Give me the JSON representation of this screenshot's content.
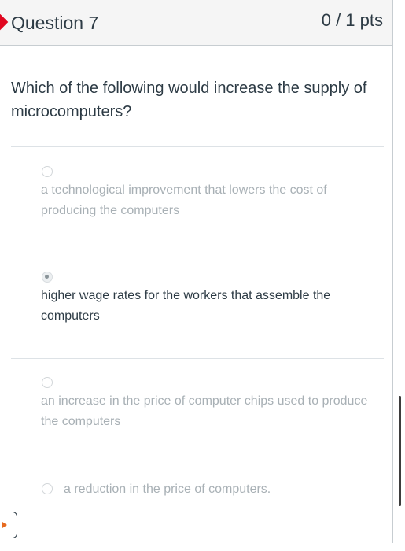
{
  "question": {
    "title": "Question 7",
    "points": "0 / 1 pts",
    "text": "Which of the following would increase the supply of microcomputers?"
  },
  "answers": [
    {
      "label": "a technological improvement that lowers the cost of producing the computers",
      "selected": false
    },
    {
      "label": "higher wage rates for the workers that assemble the computers",
      "selected": true
    },
    {
      "label": "an increase in the price of computer chips used to produce the computers",
      "selected": false
    },
    {
      "label": "a reduction in the price of computers.",
      "selected": false
    }
  ],
  "colors": {
    "flag": "#e0061f",
    "text": "#2d3b45",
    "muted_text": "#a8b0b5",
    "nav_arrow": "#e66a1f"
  }
}
